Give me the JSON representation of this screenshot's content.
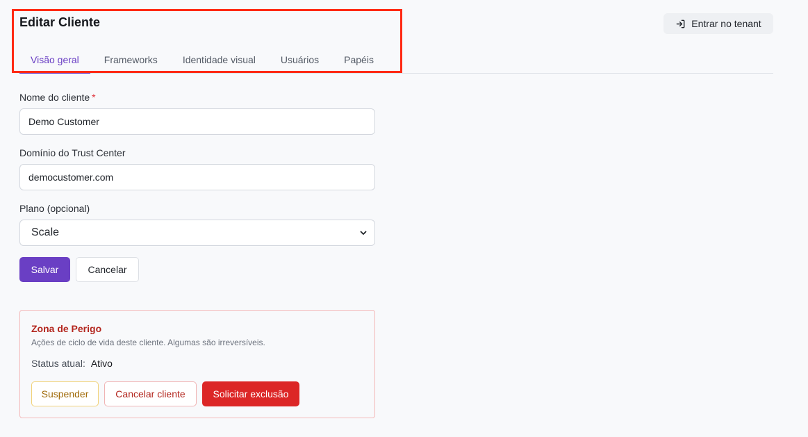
{
  "header": {
    "title": "Editar Cliente",
    "enter_tenant_label": "Entrar no tenant"
  },
  "tabs": [
    {
      "label": "Visão geral",
      "active": true
    },
    {
      "label": "Frameworks",
      "active": false
    },
    {
      "label": "Identidade visual",
      "active": false
    },
    {
      "label": "Usuários",
      "active": false
    },
    {
      "label": "Papéis",
      "active": false
    }
  ],
  "form": {
    "name_label": "Nome do cliente",
    "required_mark": "*",
    "name_value": "Demo Customer",
    "domain_label": "Domínio do Trust Center",
    "domain_value": "democustomer.com",
    "plan_label": "Plano (opcional)",
    "plan_value": "Scale",
    "save_label": "Salvar",
    "cancel_label": "Cancelar"
  },
  "danger_zone": {
    "title": "Zona de Perigo",
    "description": "Ações de ciclo de vida deste cliente. Algumas são irreversíveis.",
    "status_label": "Status atual:",
    "status_value": "Ativo",
    "suspend_label": "Suspender",
    "cancel_customer_label": "Cancelar cliente",
    "request_delete_label": "Solicitar exclusão"
  },
  "colors": {
    "accent": "#6a3fc4",
    "danger": "#dc2626",
    "highlight": "#ff2a14"
  },
  "icons": {
    "enter_tenant": "sign-in-icon",
    "select": "chevron-down-icon"
  }
}
